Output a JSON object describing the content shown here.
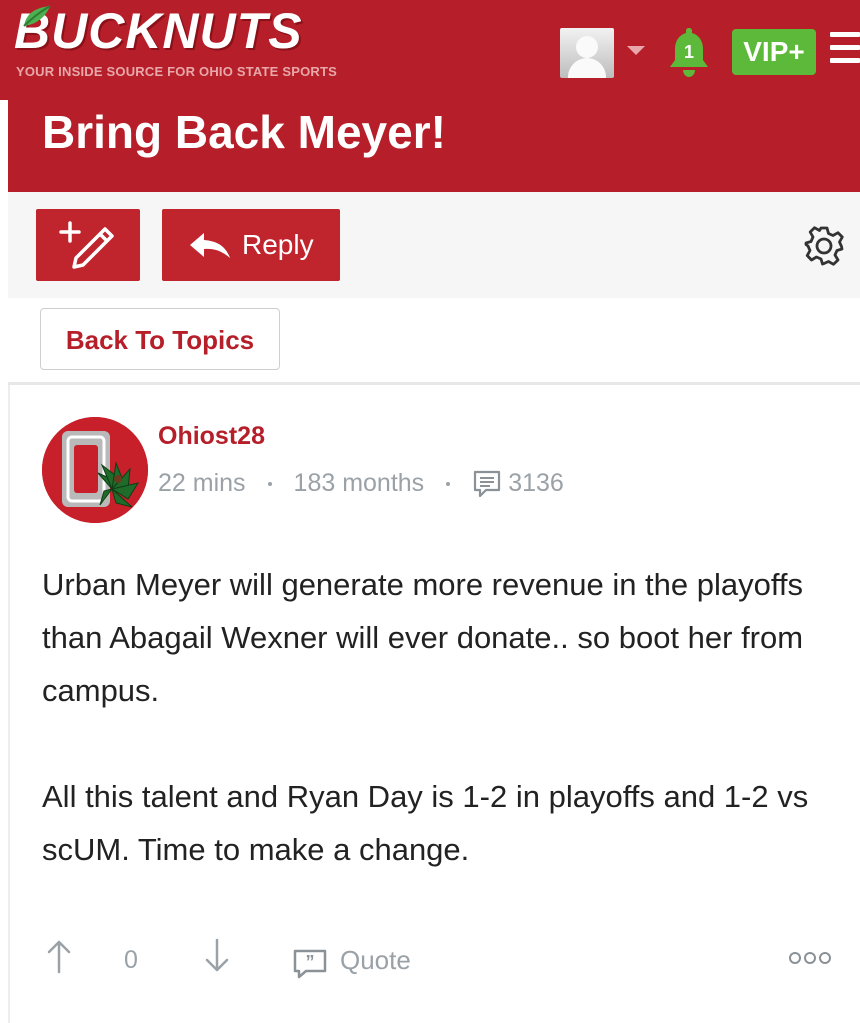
{
  "header": {
    "logo_text": "BUCKNUTS",
    "logo_tagline": "YOUR INSIDE SOURCE FOR OHIO STATE SPORTS",
    "notification_count": "1",
    "vip_label": "VIP+",
    "brand_color": "#b61f29"
  },
  "thread": {
    "title": "Bring Back Meyer!"
  },
  "toolbar": {
    "reply_label": "Reply"
  },
  "nav": {
    "back_label": "Back To Topics"
  },
  "post": {
    "username": "Ohiost28",
    "time_ago": "22 mins",
    "member_for": "183 months",
    "post_count": "3136",
    "body": [
      "Urban Meyer will generate more revenue in the playoffs than Abagail Wexner will ever donate.. so boot her from campus.",
      "All this talent and Ryan Day is 1-2 in playoffs and 1-2 vs scUM. Time to make a change."
    ],
    "vote_count": "0",
    "quote_label": "Quote"
  }
}
